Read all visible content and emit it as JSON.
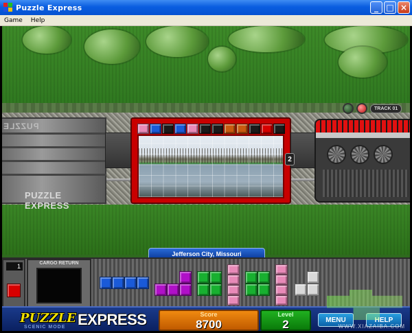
{
  "window": {
    "title": "Puzzle Express",
    "minimize": "_",
    "maximize": "□",
    "close": "×"
  },
  "menu": [
    "Game",
    "Help"
  ],
  "scene": {
    "track_label": "TRACK 01",
    "left_car_brand": "PUZZLE EXPRESS",
    "left_car_brand_top": "PUZZLE",
    "coupler_badge": "2",
    "blocks_top": [
      "#e88ab8",
      "#1a5ad8",
      "#1a1a1a",
      "#1a5ad8",
      "#e88ab8",
      "#1a1a1a",
      "#1a1a1a",
      "#c85a10",
      "#c85a10",
      "#1a1a1a",
      "#d80000",
      "#1a1a1a"
    ]
  },
  "panel": {
    "location": "Jefferson City, Missouri",
    "mini_count": "1",
    "cargo_return_label": "CARGO RETURN"
  },
  "scorebar": {
    "logo_puzzle": "PUZZLE",
    "logo_express": "EXPRESS",
    "logo_sub": "SCENIC MODE",
    "score_label": "Score",
    "score_value": "8700",
    "level_label": "Level",
    "level_value": "2",
    "menu_button": "MENU",
    "help_button": "HELP"
  },
  "watermark": "WWW.XIAZAIBA.COM",
  "colors": {
    "blue": "#1a5ad8",
    "purple": "#b010c8",
    "green": "#18b030",
    "pink": "#e88ab8",
    "grey": "#d8d8d8",
    "red": "#d80000",
    "orange": "#c85a10"
  }
}
